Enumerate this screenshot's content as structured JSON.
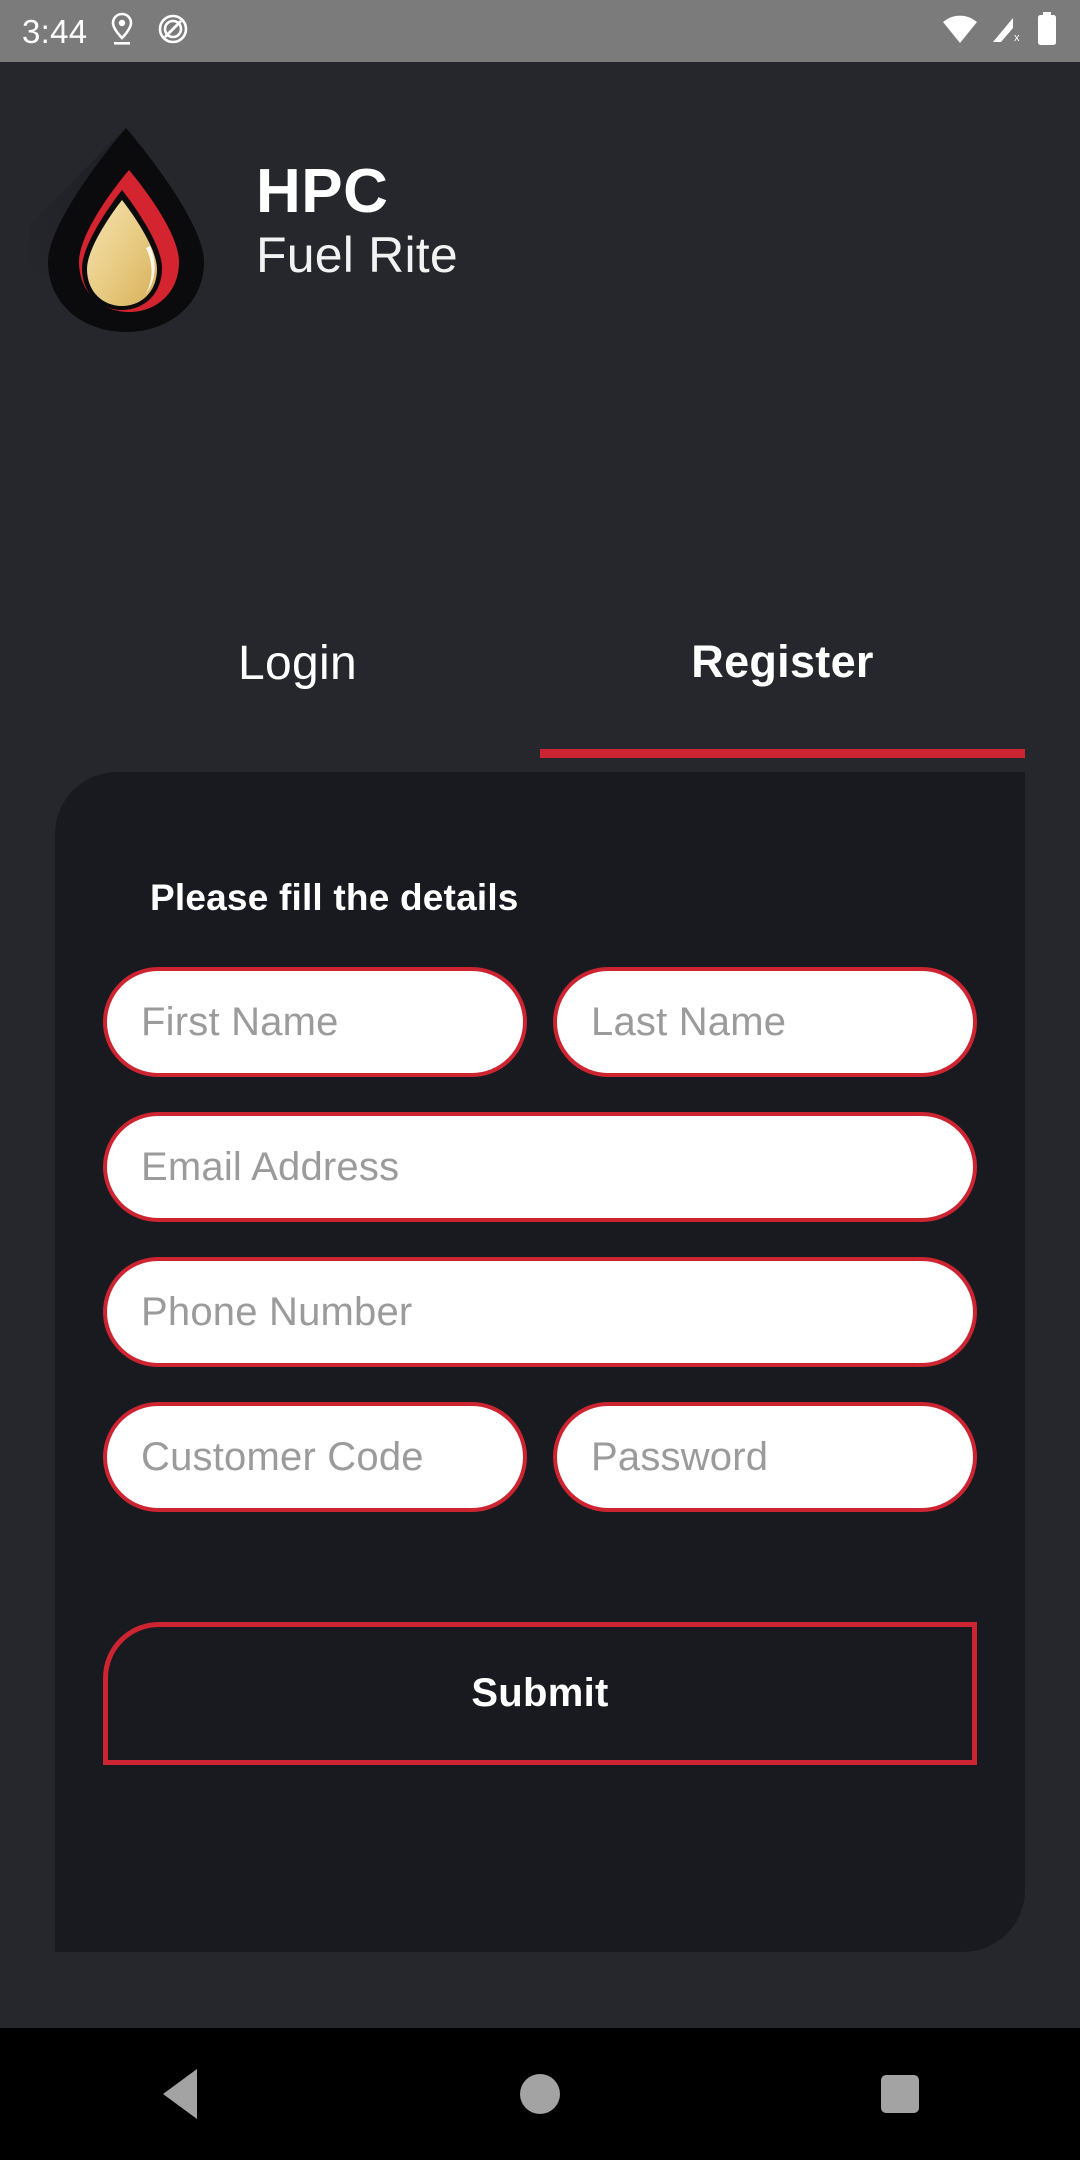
{
  "status_bar": {
    "time": "3:44",
    "left_icons": [
      "location-pin-icon",
      "dnd-blocked-icon"
    ],
    "right_icons": [
      "wifi-icon",
      "cellular-signal-off-icon",
      "battery-full-icon"
    ]
  },
  "brand": {
    "logo": "fuel-droplet-logo",
    "title": "HPC",
    "subtitle": "Fuel Rite"
  },
  "tabs": [
    {
      "label": "Login",
      "active": false
    },
    {
      "label": "Register",
      "active": true
    }
  ],
  "card": {
    "title": "Please fill the details",
    "fields": [
      {
        "name": "first-name",
        "placeholder": "First Name",
        "value": "",
        "width": "half"
      },
      {
        "name": "last-name",
        "placeholder": "Last Name",
        "value": "",
        "width": "half"
      },
      {
        "name": "email",
        "placeholder": "Email Address",
        "value": "",
        "width": "full"
      },
      {
        "name": "phone",
        "placeholder": "Phone Number",
        "value": "",
        "width": "full"
      },
      {
        "name": "customer-code",
        "placeholder": "Customer Code",
        "value": "",
        "width": "half"
      },
      {
        "name": "password",
        "placeholder": "Password",
        "value": "",
        "width": "half"
      }
    ],
    "submit_label": "Submit"
  },
  "nav_bar": {
    "back_label": "Back",
    "home_label": "Home",
    "recents_label": "Recents"
  },
  "colors": {
    "accent_red": "#cc2431",
    "page_bg": "#26272c",
    "card_bg": "#191a1f",
    "status_bar_bg": "#7b7b7b",
    "nav_bar_bg": "#000000",
    "field_bg": "#ffffff",
    "placeholder": "#9b9b9b",
    "logo_gold": "#e8c87a",
    "logo_red": "#d32430",
    "logo_black": "#0a0a0a"
  }
}
